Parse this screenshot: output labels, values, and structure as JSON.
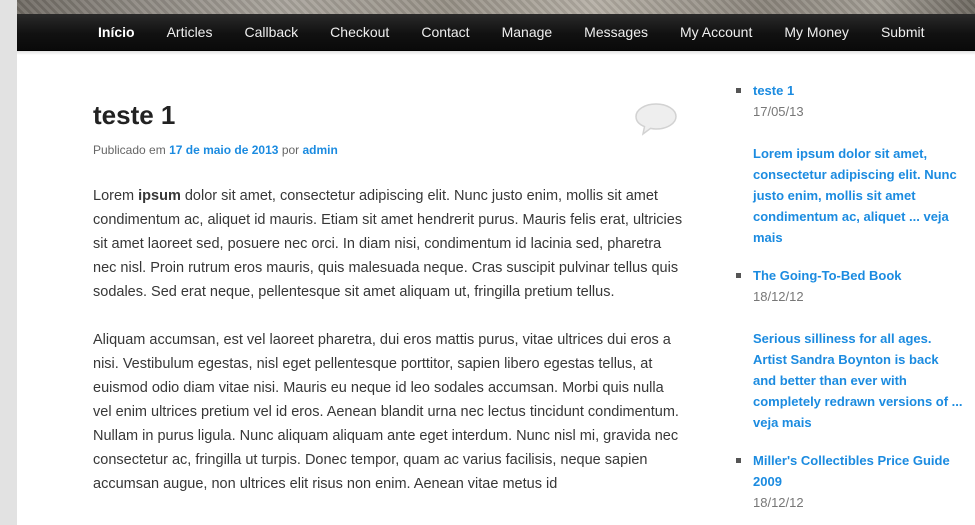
{
  "nav": {
    "items": [
      {
        "label": "Início",
        "active": true
      },
      {
        "label": "Articles"
      },
      {
        "label": "Callback"
      },
      {
        "label": "Checkout"
      },
      {
        "label": "Contact"
      },
      {
        "label": "Manage"
      },
      {
        "label": "Messages"
      },
      {
        "label": "My Account"
      },
      {
        "label": "My Money"
      },
      {
        "label": "Submit"
      }
    ]
  },
  "post": {
    "title": "teste 1",
    "meta": {
      "prefix": "Publicado em",
      "date": "17 de maio de 2013",
      "by": "por",
      "author": "admin"
    },
    "paragraph1": {
      "before_bold": "Lorem ",
      "bold": "ipsum",
      "after_bold": " dolor sit amet, consectetur adipiscing elit. Nunc justo enim, mollis sit amet condimentum ac, aliquet id mauris. Etiam sit amet hendrerit purus. Mauris felis erat, ultricies sit amet laoreet sed, posuere nec orci. In diam nisi, condimentum id lacinia sed, pharetra nec nisl. Proin rutrum eros mauris, quis malesuada neque. Cras suscipit pulvinar tellus quis sodales. Sed erat neque, pellentesque sit amet aliquam ut, fringilla pretium tellus."
    },
    "paragraph2": "Aliquam accumsan, est vel laoreet pharetra, dui eros mattis purus, vitae ultrices dui eros a nisi. Vestibulum egestas, nisl eget pellentesque porttitor, sapien libero egestas tellus, at euismod odio diam vitae nisi. Mauris eu neque id leo sodales accumsan. Morbi quis nulla vel enim ultrices pretium vel id eros. Aenean blandit urna nec lectus tincidunt condimentum. Nullam in purus ligula. Nunc aliquam aliquam ante eget interdum. Nunc nisl mi, gravida nec consectetur ac, fringilla ut turpis. Donec tempor, quam ac varius facilisis, neque sapien accumsan augue, non ultrices elit risus non enim. Aenean vitae metus id"
  },
  "comment_icon": "speech-bubble-icon",
  "sidebar": {
    "items": [
      {
        "title": "teste 1",
        "date": "17/05/13",
        "excerpt": "Lorem ipsum dolor sit amet, consectetur adipiscing elit. Nunc justo enim, mollis sit amet condimentum ac, aliquet ... veja mais"
      },
      {
        "title": "The Going-To-Bed Book",
        "date": "18/12/12",
        "excerpt": "Serious silliness for all ages. Artist Sandra Boynton is back and better than ever with completely redrawn versions of ... veja mais"
      },
      {
        "title": "Miller's Collectibles Price Guide 2009",
        "date": "18/12/12"
      }
    ]
  },
  "colors": {
    "link": "#1b8be0",
    "nav_bg": "#111111",
    "text": "#373737"
  }
}
